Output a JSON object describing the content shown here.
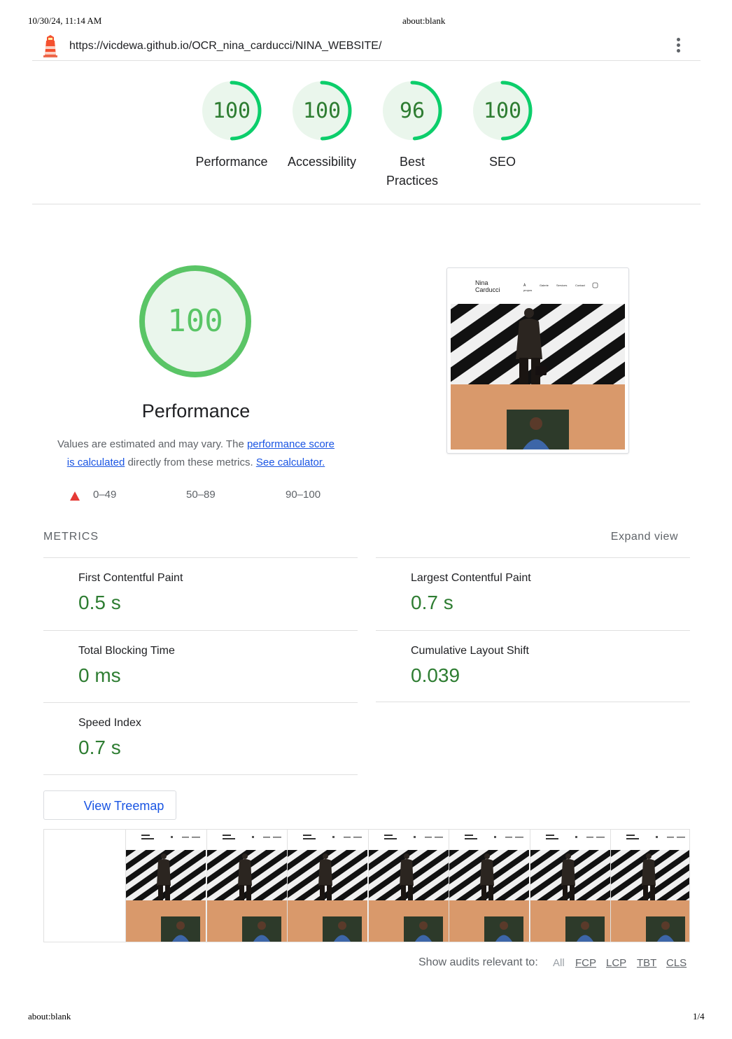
{
  "print_header": {
    "datetime": "10/30/24, 11:14 AM",
    "title": "about:blank"
  },
  "print_footer": {
    "left": "about:blank",
    "page": "1/4"
  },
  "topbar": {
    "url": "https://vicdewa.github.io/OCR_nina_carducci/NINA_WEBSITE/",
    "logo_icon": "lighthouse-icon",
    "menu_icon": "kebab-menu-icon"
  },
  "scores": [
    {
      "value": "100",
      "label": "Performance",
      "fraction": 1.0
    },
    {
      "value": "100",
      "label": "Accessibility",
      "fraction": 1.0
    },
    {
      "value": "96",
      "label_line1": "Best",
      "label_line2": "Practices",
      "fraction": 0.96
    },
    {
      "value": "100",
      "label": "SEO",
      "fraction": 1.0
    }
  ],
  "colors": {
    "pass": "#0cce6b",
    "pass_text": "#2e7d32",
    "pass_bg": "#eaf6ec",
    "fail": "#e53935",
    "link": "#1a55e3"
  },
  "performance": {
    "score": "100",
    "title": "Performance",
    "desc_pre": "Values are estimated and may vary. The ",
    "link_score": "performance score",
    "link_calculated": "is calculated",
    "desc_mid": " directly from these metrics. ",
    "link_calculator": "See calculator.",
    "legend": [
      "0–49",
      "50–89",
      "90–100"
    ]
  },
  "screenshot": {
    "site_name_line1": "Nina",
    "site_name_line2": "Carducci",
    "nav_apropos_1": "À",
    "nav_apropos_2": "propos",
    "nav_galerie": "Galerie",
    "nav_services": "Services",
    "nav_contact": "Contact"
  },
  "metrics": {
    "header": "METRICS",
    "expand": "Expand view",
    "items": [
      {
        "label": "First Contentful Paint",
        "value": "0.5 s"
      },
      {
        "label": "Largest Contentful Paint",
        "value": "0.7 s"
      },
      {
        "label": "Total Blocking Time",
        "value": "0 ms"
      },
      {
        "label": "Cumulative Layout Shift",
        "value": "0.039"
      },
      {
        "label": "Speed Index",
        "value": "0.7 s"
      }
    ]
  },
  "treemap_button": "View Treemap",
  "filmstrip_frames": 7,
  "audits": {
    "label": "Show audits relevant to:",
    "all": "All",
    "filters": [
      "FCP",
      "LCP",
      "TBT",
      "CLS"
    ]
  }
}
